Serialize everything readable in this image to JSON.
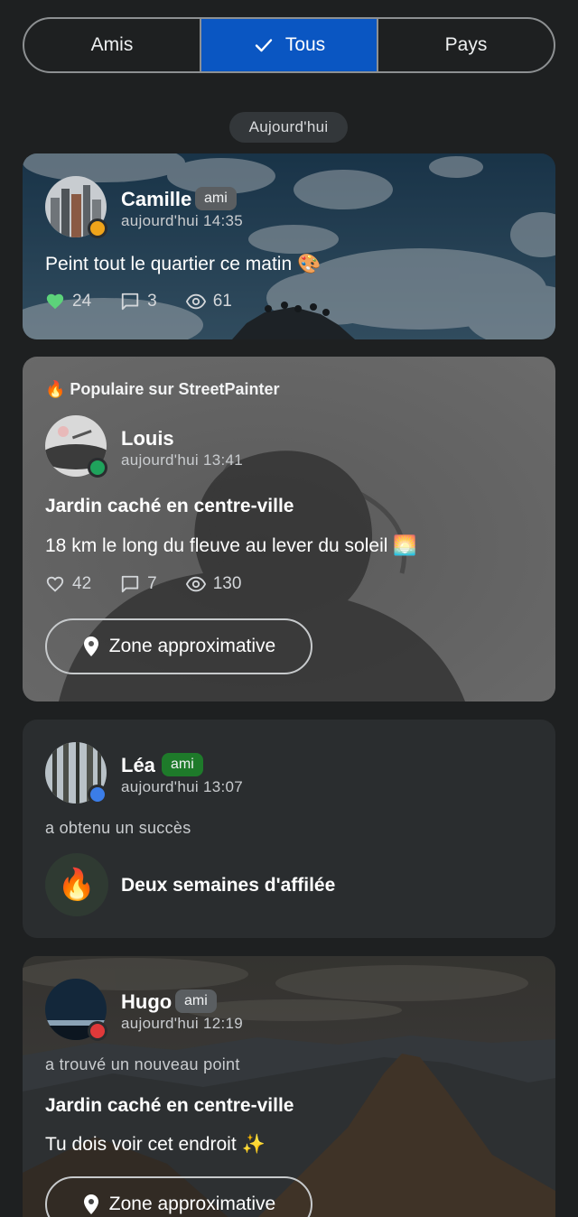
{
  "filters": {
    "tabs": [
      {
        "label": "Amis"
      },
      {
        "label": "Tous"
      },
      {
        "label": "Pays"
      }
    ],
    "active": "Tous"
  },
  "date_separator": "Aujourd'hui",
  "colors": {
    "accent": "#0a56c2",
    "background": "#1e2021",
    "friend_tag_green": "#1e7a2a",
    "like_green": "#5cd37a"
  },
  "feed": {
    "post1": {
      "user": "Camille",
      "tag": "ami",
      "time": "aujourd'hui 14:35",
      "text": "Peint tout le quartier ce matin 🎨",
      "likes": "24",
      "comments": "3",
      "views": "61",
      "status_color": "#f0a41a"
    },
    "post2": {
      "popular_label": "🔥 Populaire sur StreetPainter",
      "user": "Louis",
      "time": "aujourd'hui 13:41",
      "title": "Jardin caché en centre-ville",
      "text": "18 km le long du fleuve au lever du soleil 🌅",
      "likes": "42",
      "comments": "7",
      "views": "130",
      "location_label": "Zone approximative",
      "status_color": "#1fa35c"
    },
    "post3": {
      "user": "Léa",
      "tag": "ami",
      "time": "aujourd'hui 13:07",
      "activity": "a obtenu un succès",
      "achievement_icon": "🔥",
      "achievement": "Deux semaines d'affilée",
      "status_color": "#3b7de8"
    },
    "post4": {
      "user": "Hugo",
      "tag": "ami",
      "time": "aujourd'hui 12:19",
      "activity": "a trouvé un nouveau point",
      "title": "Jardin caché en centre-ville",
      "text": "Tu dois voir cet endroit ✨",
      "location_label": "Zone approximative",
      "status_color": "#e0393a"
    }
  }
}
